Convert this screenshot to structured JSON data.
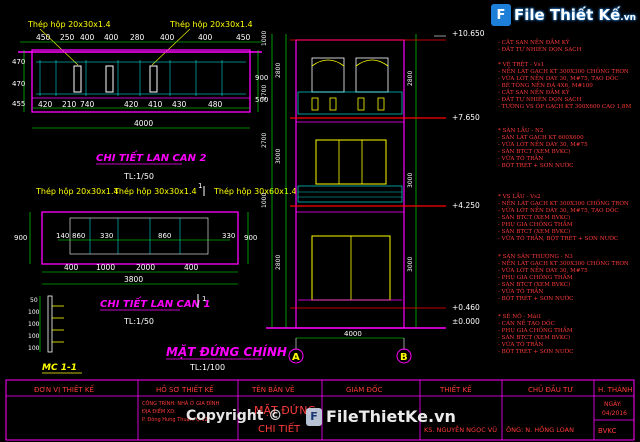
{
  "watermark": {
    "brand": "File Thiết Kế",
    "brand_suffix": ".vn",
    "copyright": "Copyright ©",
    "bottom_brand": "FileThietKe.vn"
  },
  "lan_can_2": {
    "label_top_left": "Thép hộp 20x30x1.4",
    "label_top_right": "Thép hộp 20x30x1.4",
    "dims_top": [
      "450",
      "250",
      "400",
      "400",
      "280",
      "400",
      "400",
      "450"
    ],
    "dims_bottom_inner": [
      "420",
      "210",
      "740",
      "420",
      "410",
      "430",
      "480"
    ],
    "dims_bottom_total": "4000",
    "dims_left": [
      "470",
      "470",
      "455"
    ],
    "dims_right": [
      "900",
      "500"
    ],
    "title": "CHI TIẾT LAN CAN 2",
    "scale": "TL:1/50"
  },
  "lan_can_1": {
    "label_1": "Thép hộp 20x30x1.4",
    "label_2": "Thép hộp 30x30x1.4",
    "label_3": "Thép hộp 30x60x1.4",
    "marker_num": "1",
    "dims_inner": [
      "140",
      "860",
      "330",
      "860",
      "330"
    ],
    "dims_bottom_row1": [
      "400",
      "1000",
      "2000",
      "400"
    ],
    "dims_bottom_total": "3800",
    "dims_left": [
      "900"
    ],
    "dims_right": [
      "900"
    ],
    "title": "CHI TIẾT LAN CAN 1",
    "scale": "TL:1/50"
  },
  "mc": {
    "title": "MC 1-1",
    "dims": [
      "50",
      "100",
      "100",
      "100",
      "100"
    ]
  },
  "elevation": {
    "levels": [
      "+10.650",
      "+7.650",
      "+4.250",
      "+0.460",
      "±0.000"
    ],
    "dims_left": [
      "1000",
      "2700",
      "2700",
      "1000",
      "2800",
      "3000",
      "2800"
    ],
    "dims_right": [
      "2800",
      "3000",
      "3000"
    ],
    "dim_bottom": "4000",
    "grid_a": "A",
    "grid_b": "B",
    "title": "MẶT ĐỨNG CHÍNH",
    "scale": "TL:1/100"
  },
  "notes": [
    {
      "head": "- CẮT SAN NỀN ĐẦM KỸ",
      "items": [
        "- ĐẮT TỰ NHIÊN DỌN SẠCH"
      ]
    },
    {
      "head": "* VỆ TRỆT - Vs1",
      "items": [
        "- NỀN LÁT GẠCH KT 300X300 CHỐNG TRƠN",
        "- VỮA LÓT NỀN DÀY 30, M#75, TẠO DỐC",
        "- BÊ TÔNG NỀN ĐÁ 4X6, M#100",
        "- CẮT SAN NỀN ĐẦM KỸ",
        "- ĐẮT TỰ NHIÊN DỌN SẠCH",
        "- TƯỜNG VS ỐP GẠCH KT 300X600 CAO 1,8M"
      ]
    },
    {
      "head": "* SÀN LẦU - N2",
      "items": [
        "- SÀN LÁT GẠCH KT 600X600",
        "- VỮA LÓT NỀN DÀY 30, M#75",
        "- SÀN BTCT (XEM BVKC)",
        "- VỮA TÔ TRẦN",
        "- BỘT TRÉT + SƠN NƯỚC"
      ]
    },
    {
      "head": "* VS LẦU - Vs2",
      "items": [
        "- NỀN LÁT GẠCH KT 300X300 CHỐNG TRƠN",
        "- VỮA LÓT NỀN DÀY 30, M#75, TẠO DỐC",
        "- SÀN BTCT (XEM BVKC)",
        "- PHỤ GIA CHỐNG THẤM",
        "- SÀN BTCT (XEM BVKC)",
        "- VỮA TÔ TRẦN, BỘT TRÉT + SƠN NƯỚC"
      ]
    },
    {
      "head": "* SÀN SÂN THƯỢNG - N3",
      "items": [
        "- NỀN LÁT GẠCH KT 300X300 CHỐNG TRƠN",
        "- VỮA LÓT NỀN DÀY 30, M#75",
        "- PHỤ GIA CHỐNG THẤM",
        "- SÀN BTCT (XEM BVKC)",
        "- VỮA TÔ TRẦN",
        "- BỘT TRÉT + SƠN NƯỚC"
      ]
    },
    {
      "head": "* SÊ NÔ - Mái1",
      "items": [
        "- CÁN NỀ TẠO DỐC",
        "- PHỤ GIA CHỐNG THẤM",
        "- SÀN BTCT (XEM BVKC)",
        "- VỮA TÔ TRẦN",
        "- BỘT TRÉT + SƠN NƯỚC"
      ]
    }
  ],
  "title_block": {
    "headers": [
      "ĐƠN VỊ THIẾT KẾ",
      "HỒ SƠ THIẾT KẾ",
      "TÊN BẢN VẼ",
      "GIÁM ĐỐC",
      "THIẾT KẾ",
      "CHỦ ĐẦU TƯ",
      "H. THÀNH"
    ],
    "project_lines": [
      "CÔNG TRÌNH: NHÀ Ở GIA ĐÌNH",
      "ĐỊA ĐIỂM XD:",
      "P. Đông Hưng Thuận, Q.12"
    ],
    "drawing_name": "MẶT ĐỨNG",
    "drawing_sub": "CHI TIẾT",
    "designer": "KS. NGUYỄN NGỌC VŨ",
    "owner": "ÔNG: N. HỒNG LOAN",
    "date_label": "NGÀY:",
    "date_value": "04/2016",
    "sheet": "BVKC"
  }
}
